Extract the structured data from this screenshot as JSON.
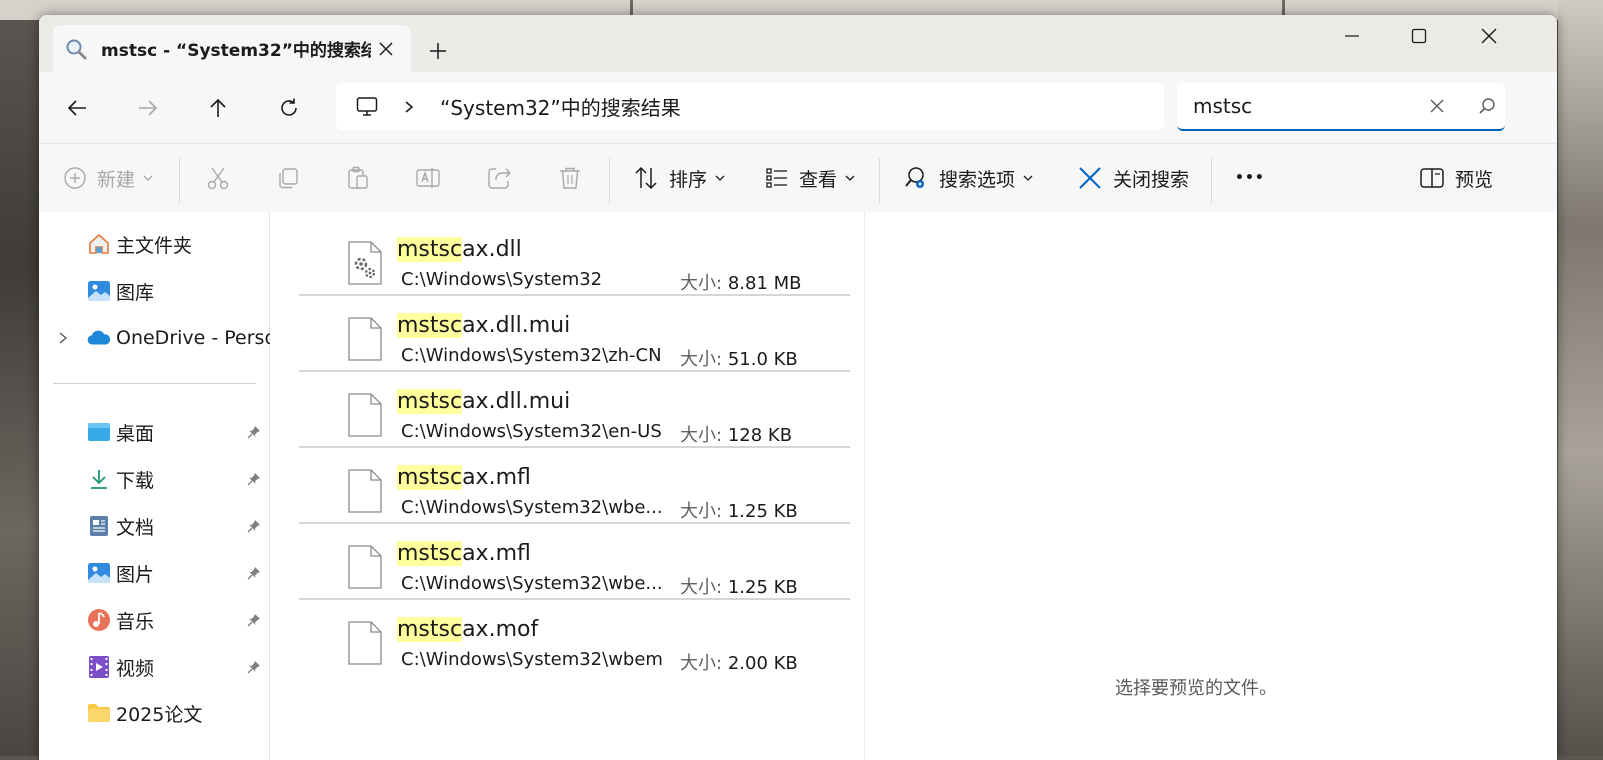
{
  "tab": {
    "title": "mstsc - “System32”中的搜索结",
    "close": "✕"
  },
  "new_tab": "+",
  "window_controls": {
    "minimize": "—",
    "maximize": "☐",
    "close": "✕"
  },
  "address": {
    "crumb": "“System32”中的搜索结果"
  },
  "search": {
    "value": "mstsc",
    "placeholder": ""
  },
  "toolbar": {
    "new_label": "新建",
    "sort_label": "排序",
    "view_label": "查看",
    "search_options_label": "搜索选项",
    "close_search_label": "关闭搜索",
    "more_label": "•••",
    "preview_label": "预览"
  },
  "sidebar": {
    "top": [
      {
        "label": "主文件夹",
        "icon": "home-icon"
      },
      {
        "label": "图库",
        "icon": "gallery-icon"
      },
      {
        "label": "OneDrive - Persor",
        "icon": "onedrive-icon"
      }
    ],
    "pinned": [
      {
        "label": "桌面",
        "icon": "desktop-icon"
      },
      {
        "label": "下载",
        "icon": "download-icon"
      },
      {
        "label": "文档",
        "icon": "documents-icon"
      },
      {
        "label": "图片",
        "icon": "pictures-icon"
      },
      {
        "label": "音乐",
        "icon": "music-icon"
      },
      {
        "label": "视频",
        "icon": "videos-icon"
      },
      {
        "label": "2025论文",
        "icon": "folder-icon"
      }
    ]
  },
  "results": [
    {
      "highlight": "mstsc",
      "rest": "ax.dll",
      "path": "C:\\Windows\\System32",
      "size_label": "大小:",
      "size": "8.81 MB",
      "icon": "dll-file-icon"
    },
    {
      "highlight": "mstsc",
      "rest": "ax.dll.mui",
      "path": "C:\\Windows\\System32\\zh-CN",
      "size_label": "大小:",
      "size": "51.0 KB",
      "icon": "file-icon"
    },
    {
      "highlight": "mstsc",
      "rest": "ax.dll.mui",
      "path": "C:\\Windows\\System32\\en-US",
      "size_label": "大小:",
      "size": "128 KB",
      "icon": "file-icon"
    },
    {
      "highlight": "mstsc",
      "rest": "ax.mfl",
      "path": "C:\\Windows\\System32\\wbe...",
      "size_label": "大小:",
      "size": "1.25 KB",
      "icon": "file-icon"
    },
    {
      "highlight": "mstsc",
      "rest": "ax.mfl",
      "path": "C:\\Windows\\System32\\wbe...",
      "size_label": "大小:",
      "size": "1.25 KB",
      "icon": "file-icon"
    },
    {
      "highlight": "mstsc",
      "rest": "ax.mof",
      "path": "C:\\Windows\\System32\\wbem",
      "size_label": "大小:",
      "size": "2.00 KB",
      "icon": "file-icon"
    }
  ],
  "preview": {
    "message": "选择要预览的文件。"
  },
  "colors": {
    "accent": "#005fb8",
    "highlight": "#ffff9e",
    "folder": "#f8c847"
  }
}
